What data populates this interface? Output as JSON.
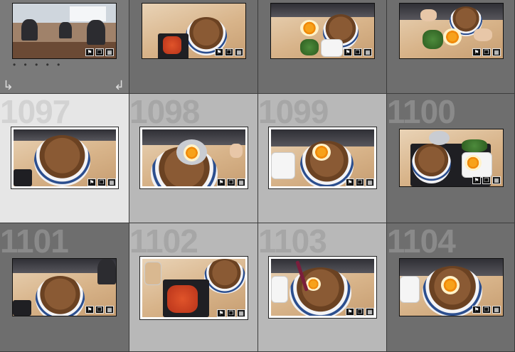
{
  "grid": {
    "rows": [
      {
        "cells": [
          {
            "number": "",
            "state": "none",
            "badges": [
              "flag-icon",
              "stack-icon",
              "crop-icon"
            ],
            "scene": "restaurant"
          },
          {
            "number": "",
            "state": "dark",
            "badges": [
              "flag-icon",
              "stack-icon",
              "crop-icon"
            ],
            "scene": "bowl-kimchi"
          },
          {
            "number": "",
            "state": "dark",
            "badges": [
              "flag-icon",
              "stack-icon",
              "crop-icon"
            ],
            "scene": "bowl-egg-greens"
          },
          {
            "number": "",
            "state": "dark",
            "badges": [
              "flag-icon",
              "stack-icon",
              "crop-icon"
            ],
            "scene": "tray-hands"
          }
        ]
      },
      {
        "cells": [
          {
            "number": "1097",
            "state": "primary",
            "badges": [
              "flag-icon",
              "stack-icon",
              "crop-icon"
            ],
            "scene": "bowl-close"
          },
          {
            "number": "1098",
            "state": "secondary",
            "badges": [
              "flag-icon",
              "stack-icon",
              "crop-icon"
            ],
            "scene": "bowl-spoon-egg"
          },
          {
            "number": "1099",
            "state": "secondary",
            "badges": [
              "flag-icon",
              "stack-icon",
              "crop-icon"
            ],
            "scene": "bowl-egg"
          },
          {
            "number": "1100",
            "state": "dark",
            "badges": [
              "flag-icon",
              "stack-icon",
              "crop-icon"
            ],
            "scene": "tray-egg-bowl"
          }
        ]
      },
      {
        "cells": [
          {
            "number": "1101",
            "state": "dark",
            "badges": [
              "flag-icon",
              "stack-icon",
              "crop-icon"
            ],
            "scene": "bowl-close"
          },
          {
            "number": "1102",
            "state": "secondary",
            "badges": [
              "flag-icon",
              "stack-icon",
              "crop-icon"
            ],
            "scene": "tray-kimchi"
          },
          {
            "number": "1103",
            "state": "secondary",
            "badges": [
              "flag-icon",
              "stack-icon",
              "crop-icon"
            ],
            "scene": "bowl-chopsticks"
          },
          {
            "number": "1104",
            "state": "dark",
            "badges": [
              "flag-icon",
              "stack-icon",
              "crop-icon"
            ],
            "scene": "bowl-egg-closeup"
          }
        ]
      }
    ]
  },
  "stack": {
    "dots": "• • • • •"
  },
  "colors": {
    "primary_cell": "#e6e6e6",
    "secondary_cell": "#b8b8b8",
    "dark_cell": "#6e6e6e",
    "accent_egg": "#f7a21a"
  }
}
